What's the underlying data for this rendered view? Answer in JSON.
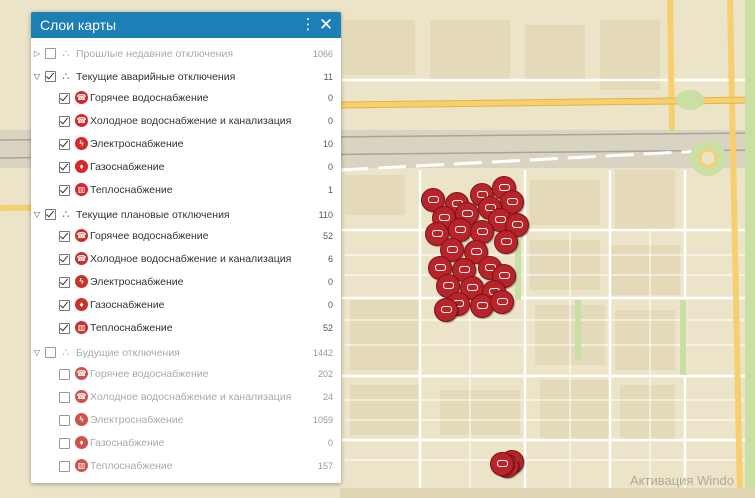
{
  "panel": {
    "title": "Слои карты"
  },
  "groups": [
    {
      "name": "Прошлые недавние отключения",
      "count": "1066",
      "expanded": false,
      "checked": false,
      "disabled": true,
      "children": []
    },
    {
      "name": "Текущие аварийные отключения",
      "count": "11",
      "expanded": true,
      "checked": true,
      "disabled": false,
      "children": [
        {
          "label": "Горячее водоснабжение",
          "count": "0",
          "checked": true,
          "icon": "hot-water-icon"
        },
        {
          "label": "Холодное водоснабжение и канализация",
          "count": "0",
          "checked": true,
          "icon": "cold-water-icon"
        },
        {
          "label": "Электроснабжение",
          "count": "10",
          "checked": true,
          "icon": "electricity-icon"
        },
        {
          "label": "Газоснабжение",
          "count": "0",
          "checked": true,
          "icon": "gas-icon"
        },
        {
          "label": "Теплоснабжение",
          "count": "1",
          "checked": true,
          "icon": "heating-icon"
        }
      ]
    },
    {
      "name": "Текущие плановые отключения",
      "count": "110",
      "expanded": true,
      "checked": true,
      "disabled": false,
      "children": [
        {
          "label": "Горячее водоснабжение",
          "count": "52",
          "checked": true,
          "icon": "hot-water-icon"
        },
        {
          "label": "Холодное водоснабжение и канализация",
          "count": "6",
          "checked": true,
          "icon": "cold-water-icon"
        },
        {
          "label": "Электроснабжение",
          "count": "0",
          "checked": true,
          "icon": "electricity-icon"
        },
        {
          "label": "Газоснабжение",
          "count": "0",
          "checked": true,
          "icon": "gas-icon"
        },
        {
          "label": "Теплоснабжение",
          "count": "52",
          "checked": true,
          "icon": "heating-icon"
        }
      ]
    },
    {
      "name": "Будущие отключения",
      "count": "1442",
      "expanded": true,
      "checked": false,
      "disabled": true,
      "children": [
        {
          "label": "Горячее водоснабжение",
          "count": "202",
          "checked": false,
          "icon": "hot-water-icon"
        },
        {
          "label": "Холодное водоснабжение и канализация",
          "count": "24",
          "checked": false,
          "icon": "cold-water-icon"
        },
        {
          "label": "Электроснабжение",
          "count": "1059",
          "checked": false,
          "icon": "electricity-icon"
        },
        {
          "label": "Газоснабжение",
          "count": "0",
          "checked": false,
          "icon": "gas-icon"
        },
        {
          "label": "Теплоснабжение",
          "count": "157",
          "checked": false,
          "icon": "heating-icon"
        }
      ]
    }
  ],
  "watermark": "Активация Windo",
  "colors": {
    "header": "#1c7fb5",
    "marker": "#b8242a",
    "map_bg": "#ece4c9",
    "road_major": "#f7cf6e",
    "road_minor": "#ffffff",
    "green": "#c9dfa4"
  }
}
